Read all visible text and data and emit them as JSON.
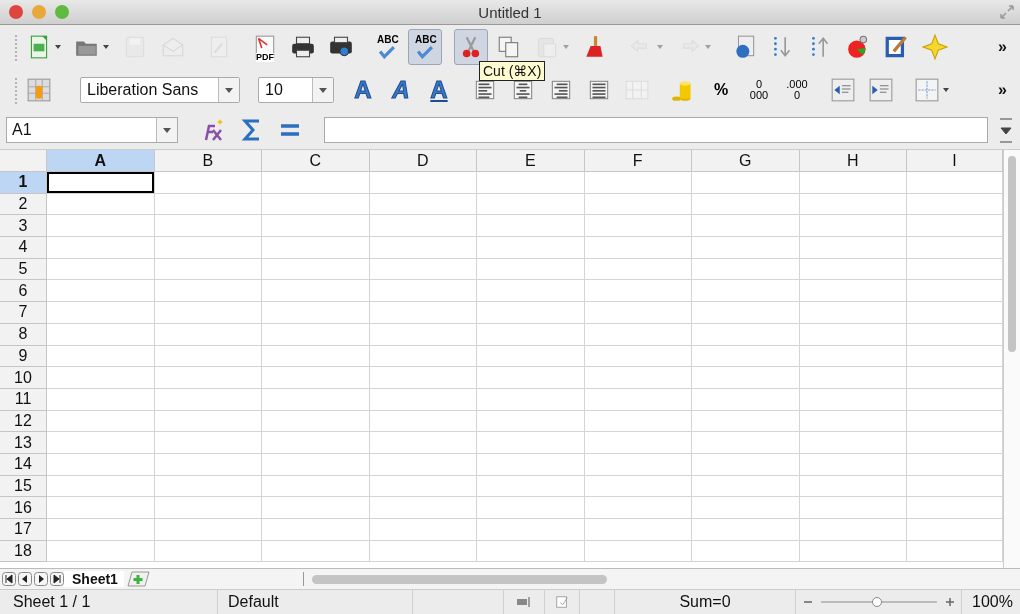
{
  "window": {
    "title": "Untitled 1"
  },
  "standard_toolbar": {
    "groups": [
      [
        {
          "kind": "new",
          "menu": true,
          "disabled": false,
          "selected": false
        },
        {
          "kind": "open",
          "menu": true,
          "disabled": false,
          "selected": false
        },
        {
          "kind": "save",
          "disabled": true,
          "selected": false
        },
        {
          "kind": "email",
          "disabled": true,
          "selected": false
        }
      ],
      [
        {
          "kind": "edit",
          "disabled": true,
          "selected": false
        }
      ],
      [
        {
          "kind": "pdf",
          "lines": [
            "PDF"
          ],
          "disabled": false,
          "selected": false
        },
        {
          "kind": "print",
          "disabled": false,
          "selected": false
        },
        {
          "kind": "preview",
          "disabled": false,
          "selected": false
        }
      ],
      [
        {
          "kind": "spell",
          "lines": [
            "ABC"
          ],
          "disabled": false,
          "selected": false
        },
        {
          "kind": "spell",
          "lines": [
            "ABC"
          ],
          "disabled": false,
          "selected": true
        }
      ],
      [
        {
          "kind": "cut",
          "disabled": false,
          "selected": true
        },
        {
          "kind": "copy",
          "disabled": false,
          "selected": false
        },
        {
          "kind": "paste",
          "menu": true,
          "disabled": true,
          "selected": false
        },
        {
          "kind": "brush",
          "disabled": false,
          "selected": false
        }
      ],
      [
        {
          "kind": "undo",
          "menu": true,
          "disabled": true,
          "selected": false
        },
        {
          "kind": "redo",
          "menu": true,
          "disabled": true,
          "selected": false
        }
      ],
      [
        {
          "kind": "navigator",
          "disabled": false,
          "selected": false
        },
        {
          "kind": "sort-down",
          "disabled": false,
          "selected": false
        },
        {
          "kind": "sort-up",
          "disabled": false,
          "selected": false
        },
        {
          "kind": "chart",
          "disabled": false,
          "selected": false
        },
        {
          "kind": "draw",
          "disabled": false,
          "selected": false
        },
        {
          "kind": "star",
          "disabled": false,
          "selected": false
        }
      ]
    ],
    "more": "»"
  },
  "formatting_toolbar": {
    "groups": [
      [
        {
          "kind": "styles",
          "disabled": false,
          "selected": false
        }
      ],
      [
        {
          "kind": "font-name",
          "value": "Liberation Sans"
        },
        {
          "kind": "font-size",
          "value": "10"
        }
      ],
      [
        {
          "kind": "bold",
          "lines": [
            "A"
          ],
          "disabled": false,
          "selected": false
        },
        {
          "kind": "italic",
          "lines": [
            "A"
          ],
          "disabled": false,
          "selected": false
        },
        {
          "kind": "underline",
          "lines": [
            "A"
          ],
          "disabled": false,
          "selected": false
        }
      ],
      [
        {
          "kind": "align-left",
          "disabled": false,
          "selected": false
        },
        {
          "kind": "align-center",
          "disabled": false,
          "selected": false
        },
        {
          "kind": "align-right",
          "disabled": false,
          "selected": false
        },
        {
          "kind": "justify",
          "disabled": false,
          "selected": false
        },
        {
          "kind": "merge",
          "disabled": true,
          "selected": false
        }
      ],
      [
        {
          "kind": "currency",
          "disabled": false,
          "selected": false
        },
        {
          "kind": "percent",
          "lines": [
            "%"
          ],
          "disabled": false,
          "selected": false
        },
        {
          "kind": "add-decimal",
          "lines": [
            "0",
            "000"
          ],
          "disabled": false,
          "selected": false
        },
        {
          "kind": "del-decimal",
          "lines": [
            ".000",
            "0"
          ],
          "disabled": false,
          "selected": false
        }
      ],
      [
        {
          "kind": "outdent",
          "disabled": false,
          "selected": false
        },
        {
          "kind": "indent",
          "disabled": false,
          "selected": false
        }
      ],
      [
        {
          "kind": "borders",
          "menu": true,
          "disabled": false,
          "selected": false
        }
      ]
    ],
    "more": "»"
  },
  "tooltip": "Cut (⌘X)",
  "formula_bar": {
    "name_box": "A1"
  },
  "columns": [
    {
      "label": "A",
      "selected": true
    },
    {
      "label": "B",
      "selected": false
    },
    {
      "label": "C",
      "selected": false
    },
    {
      "label": "D",
      "selected": false
    },
    {
      "label": "E",
      "selected": false
    },
    {
      "label": "F",
      "selected": false
    },
    {
      "label": "G",
      "selected": false
    },
    {
      "label": "H",
      "selected": false
    },
    {
      "label": "I",
      "selected": false
    }
  ],
  "rows": [
    {
      "label": "1",
      "selected": true
    },
    {
      "label": "2",
      "selected": false
    },
    {
      "label": "3",
      "selected": false
    },
    {
      "label": "4",
      "selected": false
    },
    {
      "label": "5",
      "selected": false
    },
    {
      "label": "6",
      "selected": false
    },
    {
      "label": "7",
      "selected": false
    },
    {
      "label": "8",
      "selected": false
    },
    {
      "label": "9",
      "selected": false
    },
    {
      "label": "10",
      "selected": false
    },
    {
      "label": "11",
      "selected": false
    },
    {
      "label": "12",
      "selected": false
    },
    {
      "label": "13",
      "selected": false
    },
    {
      "label": "14",
      "selected": false
    },
    {
      "label": "15",
      "selected": false
    },
    {
      "label": "16",
      "selected": false
    },
    {
      "label": "17",
      "selected": false
    },
    {
      "label": "18",
      "selected": false
    }
  ],
  "sheet_tabs": [
    {
      "label": "Sheet1",
      "selected": true
    }
  ],
  "status_bar": {
    "sheet": "Sheet 1 / 1",
    "page_style": "Default",
    "sum": "Sum=0",
    "zoom": {
      "level": 0.49,
      "reading": "100%"
    }
  }
}
